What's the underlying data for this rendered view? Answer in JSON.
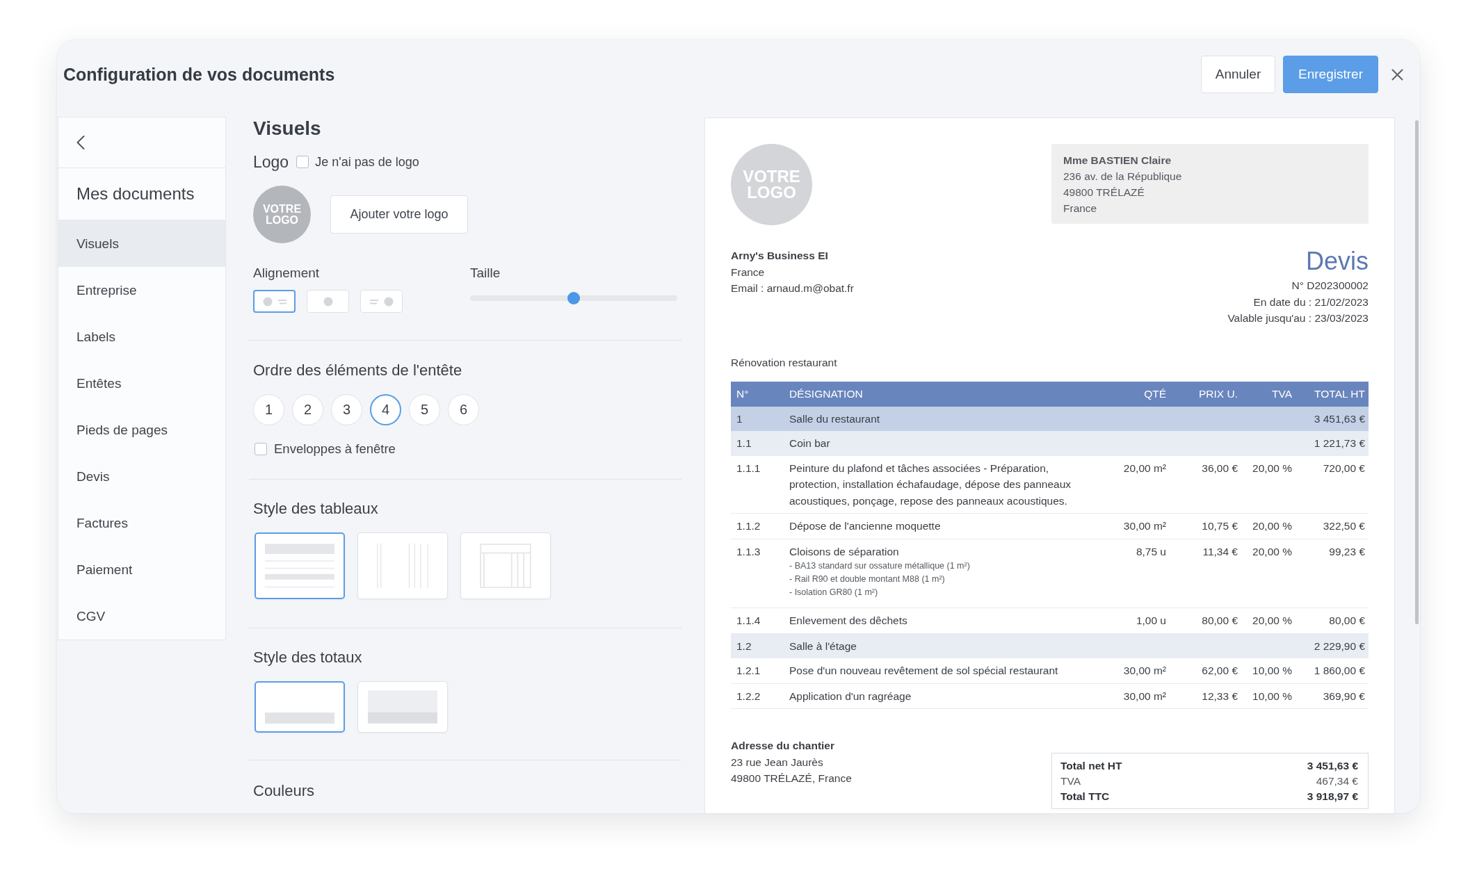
{
  "window": {
    "title": "Configuration de vos documents",
    "buttons": [
      {
        "label": "Annuler",
        "kind": "secondary"
      },
      {
        "label": "Enregistrer",
        "kind": "primary"
      }
    ]
  },
  "sidebar": {
    "heading": "Mes documents",
    "items": [
      {
        "label": "Visuels",
        "selected": true
      },
      {
        "label": "Entreprise",
        "selected": false
      },
      {
        "label": "Labels",
        "selected": false
      },
      {
        "label": "Entêtes",
        "selected": false
      },
      {
        "label": "Pieds de pages",
        "selected": false
      },
      {
        "label": "Devis",
        "selected": false
      },
      {
        "label": "Factures",
        "selected": false
      },
      {
        "label": "Paiement",
        "selected": false
      },
      {
        "label": "CGV",
        "selected": false
      }
    ]
  },
  "settings": {
    "title": "Visuels",
    "logo": {
      "label": "Logo",
      "no_logo": {
        "label": "Je n'ai pas de logo",
        "checked": false
      },
      "placeholder_text": "VOTRE LOGO",
      "upload_button": "Ajouter votre logo"
    },
    "alignment": {
      "label": "Alignement",
      "options": [
        {
          "kind": "left",
          "selected": true
        },
        {
          "kind": "center",
          "selected": false
        },
        {
          "kind": "right",
          "selected": false
        }
      ]
    },
    "size": {
      "label": "Taille",
      "level": 0.5
    },
    "header_order": {
      "title": "Ordre des éléments de l'entête",
      "options": [
        {
          "label": "1",
          "selected": false
        },
        {
          "label": "2",
          "selected": false
        },
        {
          "label": "3",
          "selected": false
        },
        {
          "label": "4",
          "selected": true
        },
        {
          "label": "5",
          "selected": false
        },
        {
          "label": "6",
          "selected": false
        }
      ]
    },
    "window_envelopes": {
      "label": "Enveloppes à fenêtre",
      "checked": false
    },
    "table_style": {
      "title": "Style des tableaux",
      "options": [
        {
          "kind": "lines",
          "selected": true
        },
        {
          "kind": "columns",
          "selected": false
        },
        {
          "kind": "grid",
          "selected": false
        }
      ]
    },
    "totals_style": {
      "title": "Style des totaux",
      "options": [
        {
          "kind": "plain",
          "selected": true
        },
        {
          "kind": "shaded",
          "selected": false
        }
      ]
    },
    "colors": {
      "title": "Couleurs"
    }
  },
  "preview": {
    "logo_text": "VOTRE LOGO",
    "recipient": {
      "name": "Mme BASTIEN Claire",
      "lines": [
        "236 av. de la République",
        "49800 TRÉLAZÉ",
        "France"
      ]
    },
    "sender": {
      "name": "Arny's Business EI",
      "lines": [
        "France",
        "Email : arnaud.m@obat.fr"
      ]
    },
    "document": {
      "title": "Devis",
      "lines": [
        "N° D202300002",
        "En date du : 21/02/2023",
        "Valable jusqu'au : 23/03/2023"
      ]
    },
    "project": "Rénovation restaurant",
    "table": {
      "columns": [
        "N°",
        "DÉSIGNATION",
        "QTÉ",
        "PRIX U.",
        "TVA",
        "TOTAL HT"
      ],
      "rows": [
        {
          "kind": "section",
          "number": "1",
          "designation": "Salle du restaurant",
          "total": "3 451,63 €"
        },
        {
          "kind": "subsection",
          "number": "1.1",
          "designation": "Coin bar",
          "total": "1 221,73 €"
        },
        {
          "kind": "item",
          "number": "1.1.1",
          "designation": "Peinture du plafond et tâches associées - Préparation, protection, installation échafaudage, dépose des panneaux acoustiques, ponçage, repose des panneaux acoustiques.",
          "quantity": "20,00 m²",
          "unit_price": "36,00 €",
          "vat": "20,00 %",
          "total": "720,00 €"
        },
        {
          "kind": "item",
          "number": "1.1.2",
          "designation": "Dépose de l'ancienne moquette",
          "quantity": "30,00 m²",
          "unit_price": "10,75 €",
          "vat": "20,00 %",
          "total": "322,50 €"
        },
        {
          "kind": "item",
          "number": "1.1.3",
          "designation": "Cloisons de séparation",
          "details": [
            "- BA13 standard sur ossature métallique (1 m²)",
            "- Rail R90 et double montant M88 (1 m²)",
            "- Isolation GR80 (1 m²)"
          ],
          "quantity": "8,75 u",
          "unit_price": "11,34 €",
          "vat": "20,00 %",
          "total": "99,23 €"
        },
        {
          "kind": "item",
          "number": "1.1.4",
          "designation": "Enlevement des dêchets",
          "quantity": "1,00 u",
          "unit_price": "80,00 €",
          "vat": "20,00 %",
          "total": "80,00 €"
        },
        {
          "kind": "subsection",
          "number": "1.2",
          "designation": "Salle à l'étage",
          "total": "2 229,90 €"
        },
        {
          "kind": "item",
          "number": "1.2.1",
          "designation": "Pose d'un nouveau revêtement de sol spécial restaurant",
          "quantity": "30,00 m²",
          "unit_price": "62,00 €",
          "vat": "10,00 %",
          "total": "1 860,00 €"
        },
        {
          "kind": "item",
          "number": "1.2.2",
          "designation": "Application d'un ragréage",
          "quantity": "30,00 m²",
          "unit_price": "12,33 €",
          "vat": "10,00 %",
          "total": "369,90 €"
        }
      ]
    },
    "site_address": {
      "title": "Adresse du chantier",
      "lines": [
        "23 rue Jean Jaurès",
        "49800 TRÉLAZÉ, France"
      ]
    },
    "totals": [
      {
        "kind": "total",
        "label": "Total net HT",
        "value": "3 451,63 €"
      },
      {
        "kind": "tax",
        "label": "TVA",
        "value": "467,34 €"
      },
      {
        "kind": "total",
        "label": "Total TTC",
        "value": "3 918,97 €"
      }
    ]
  }
}
